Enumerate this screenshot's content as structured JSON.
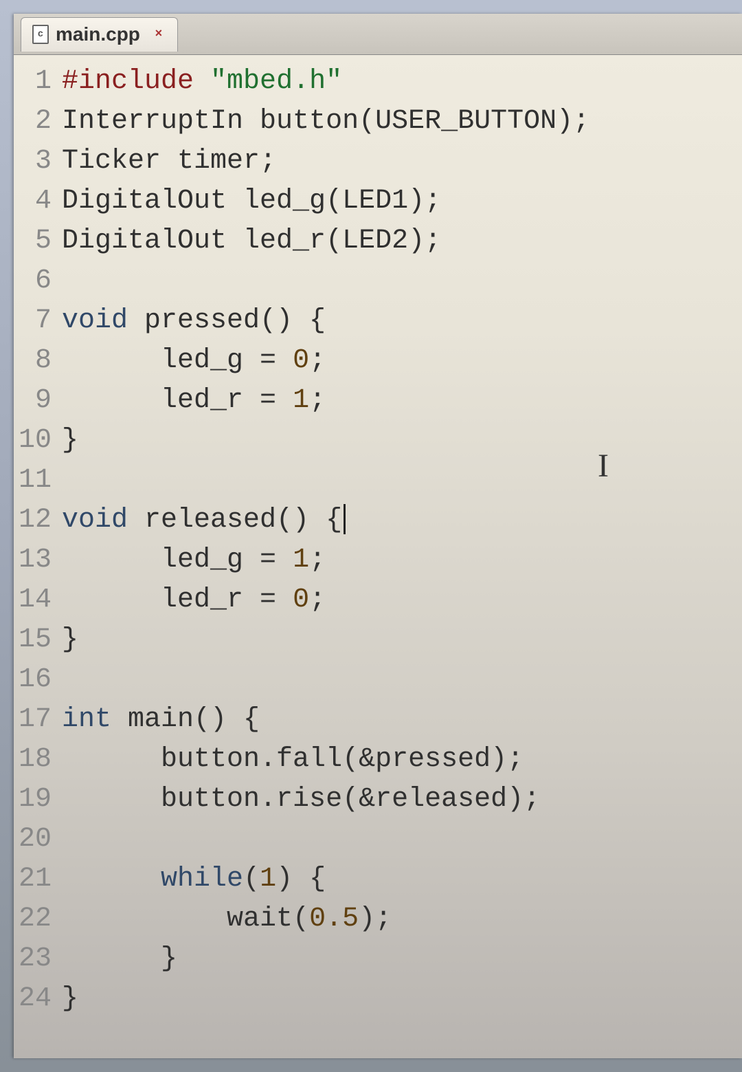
{
  "tab": {
    "filename": "main.cpp",
    "icon_letter": "c",
    "close_glyph": "×"
  },
  "code": {
    "lines": [
      {
        "num": "1",
        "tokens": [
          {
            "cls": "kw-preproc",
            "t": "#include "
          },
          {
            "cls": "kw-string",
            "t": "\"mbed.h\""
          }
        ]
      },
      {
        "num": "2",
        "tokens": [
          {
            "cls": "kw-ident",
            "t": "InterruptIn button(USER_BUTTON);"
          }
        ]
      },
      {
        "num": "3",
        "tokens": [
          {
            "cls": "kw-ident",
            "t": "Ticker timer;"
          }
        ]
      },
      {
        "num": "4",
        "tokens": [
          {
            "cls": "kw-ident",
            "t": "DigitalOut led_g(LED1);"
          }
        ]
      },
      {
        "num": "5",
        "tokens": [
          {
            "cls": "kw-ident",
            "t": "DigitalOut led_r(LED2);"
          }
        ]
      },
      {
        "num": "6",
        "tokens": []
      },
      {
        "num": "7",
        "tokens": [
          {
            "cls": "kw-keyword",
            "t": "void"
          },
          {
            "cls": "kw-ident",
            "t": " pressed() {"
          }
        ]
      },
      {
        "num": "8",
        "tokens": [
          {
            "cls": "kw-ident",
            "t": "      led_g = "
          },
          {
            "cls": "kw-num",
            "t": "0"
          },
          {
            "cls": "kw-ident",
            "t": ";"
          }
        ]
      },
      {
        "num": "9",
        "tokens": [
          {
            "cls": "kw-ident",
            "t": "      led_r = "
          },
          {
            "cls": "kw-num",
            "t": "1"
          },
          {
            "cls": "kw-ident",
            "t": ";"
          }
        ]
      },
      {
        "num": "10",
        "tokens": [
          {
            "cls": "kw-ident",
            "t": "}"
          }
        ]
      },
      {
        "num": "11",
        "tokens": []
      },
      {
        "num": "12",
        "tokens": [
          {
            "cls": "kw-keyword",
            "t": "void"
          },
          {
            "cls": "kw-ident",
            "t": " released() {"
          }
        ],
        "caret": true
      },
      {
        "num": "13",
        "tokens": [
          {
            "cls": "kw-ident",
            "t": "      led_g = "
          },
          {
            "cls": "kw-num",
            "t": "1"
          },
          {
            "cls": "kw-ident",
            "t": ";"
          }
        ]
      },
      {
        "num": "14",
        "tokens": [
          {
            "cls": "kw-ident",
            "t": "      led_r = "
          },
          {
            "cls": "kw-num",
            "t": "0"
          },
          {
            "cls": "kw-ident",
            "t": ";"
          }
        ]
      },
      {
        "num": "15",
        "tokens": [
          {
            "cls": "kw-ident",
            "t": "}"
          }
        ]
      },
      {
        "num": "16",
        "tokens": []
      },
      {
        "num": "17",
        "tokens": [
          {
            "cls": "kw-keyword",
            "t": "int"
          },
          {
            "cls": "kw-ident",
            "t": " main() {"
          }
        ]
      },
      {
        "num": "18",
        "tokens": [
          {
            "cls": "kw-ident",
            "t": "      button.fall(&pressed);"
          }
        ]
      },
      {
        "num": "19",
        "tokens": [
          {
            "cls": "kw-ident",
            "t": "      button.rise(&released);"
          }
        ]
      },
      {
        "num": "20",
        "tokens": []
      },
      {
        "num": "21",
        "tokens": [
          {
            "cls": "kw-ident",
            "t": "      "
          },
          {
            "cls": "kw-keyword",
            "t": "while"
          },
          {
            "cls": "kw-ident",
            "t": "("
          },
          {
            "cls": "kw-num",
            "t": "1"
          },
          {
            "cls": "kw-ident",
            "t": ") {"
          }
        ]
      },
      {
        "num": "22",
        "tokens": [
          {
            "cls": "kw-ident",
            "t": "          wait("
          },
          {
            "cls": "kw-num",
            "t": "0.5"
          },
          {
            "cls": "kw-ident",
            "t": ");"
          }
        ]
      },
      {
        "num": "23",
        "tokens": [
          {
            "cls": "kw-ident",
            "t": "      }"
          }
        ]
      },
      {
        "num": "24",
        "tokens": [
          {
            "cls": "kw-ident",
            "t": "}"
          }
        ]
      }
    ]
  },
  "mouse_cursor_glyph": "I"
}
